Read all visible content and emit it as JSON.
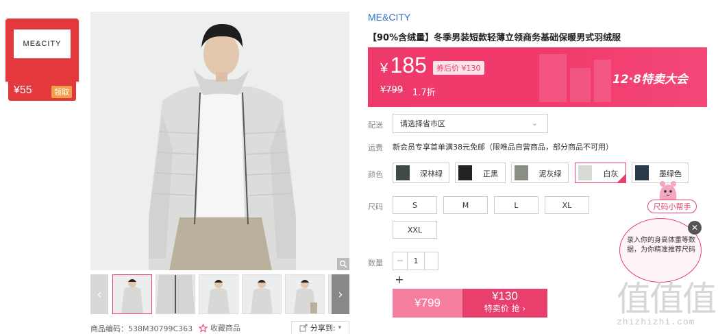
{
  "coupon": {
    "logo": "ME&CITY",
    "amount": "¥55",
    "get_label": "领取"
  },
  "gallery": {
    "code_label": "商品编码：538M30799C363",
    "fav_label": "收藏商品",
    "share_label": "分享到:"
  },
  "product": {
    "brand": "ME&CITY",
    "title": "【90%含绒量】冬季男装短款轻薄立领商务基础保暖男式羽绒服",
    "price_currency": "¥",
    "price": "185",
    "coupon_price": "券后价 ¥130",
    "original_price": "¥799",
    "discount": "1.7折",
    "event": "12·8特卖大会"
  },
  "shipping": {
    "label": "配送",
    "placeholder": "请选择省市区"
  },
  "freight": {
    "label": "运费",
    "text": "新会员专享首单满38元免邮（限唯品自营商品，部分商品不可用）"
  },
  "colors": {
    "label": "颜色",
    "options": [
      {
        "name": "深林绿",
        "swatch": "#3f4a45"
      },
      {
        "name": "正黑",
        "swatch": "#222222"
      },
      {
        "name": "泥灰绿",
        "swatch": "#8a8f86"
      },
      {
        "name": "白灰",
        "swatch": "#d9d9d6"
      },
      {
        "name": "墨绿色",
        "swatch": "#2b3a4a"
      }
    ],
    "selected": "白灰"
  },
  "sizes": {
    "label": "尺码",
    "options": [
      "S",
      "M",
      "L",
      "XL",
      "XXL"
    ]
  },
  "quantity": {
    "label": "数量",
    "value": "1",
    "minus": "−",
    "plus": "+"
  },
  "buy": {
    "normal_price": "¥799",
    "special_price": "¥130",
    "special_label": "特卖价 抢 ›"
  },
  "helper": {
    "title": "尺码小帮手",
    "text": "录入你的身高体重等数据，为你精准推荐尺码",
    "close": "✕"
  },
  "watermark": {
    "big": "值值值",
    "small": "zhizhizhi.com"
  },
  "colors_theme": {
    "accent": "#e83f6d",
    "brand_blue": "#2f6fc1",
    "coupon_red": "#e4393c"
  }
}
